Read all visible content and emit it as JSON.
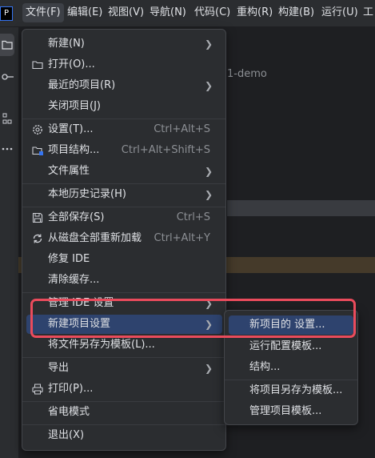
{
  "menubar": {
    "logo": "P",
    "items": [
      "文件(F)",
      "编辑(E)",
      "视图(V)",
      "导航(N)",
      "代码(C)",
      "重构(R)",
      "构建(B)",
      "运行(U)",
      "工"
    ]
  },
  "background": {
    "project_text": "1-demo"
  },
  "file_menu": {
    "items": [
      {
        "label": "新建(N)",
        "shortcut": "",
        "icon": ""
      },
      {
        "label": "打开(O)...",
        "shortcut": "",
        "icon": "folder-icon"
      },
      {
        "label": "最近的项目(R)",
        "shortcut": "",
        "icon": ""
      },
      {
        "label": "关闭项目(J)",
        "shortcut": "",
        "icon": ""
      },
      {
        "label": "设置(T)...",
        "shortcut": "Ctrl+Alt+S",
        "icon": "gear-icon"
      },
      {
        "label": "项目结构...",
        "shortcut": "Ctrl+Alt+Shift+S",
        "icon": "project-structure-icon"
      },
      {
        "label": "文件属性",
        "shortcut": "",
        "icon": ""
      },
      {
        "label": "本地历史记录(H)",
        "shortcut": "",
        "icon": ""
      },
      {
        "label": "全部保存(S)",
        "shortcut": "Ctrl+S",
        "icon": "save-icon"
      },
      {
        "label": "从磁盘全部重新加载",
        "shortcut": "Ctrl+Alt+Y",
        "icon": "reload-icon"
      },
      {
        "label": "修复 IDE",
        "shortcut": "",
        "icon": ""
      },
      {
        "label": "清除缓存...",
        "shortcut": "",
        "icon": ""
      },
      {
        "label": "管理 IDE 设置",
        "shortcut": "",
        "icon": ""
      },
      {
        "label": "新建项目设置",
        "shortcut": "",
        "icon": ""
      },
      {
        "label": "将文件另存为模板(L)...",
        "shortcut": "",
        "icon": ""
      },
      {
        "label": "导出",
        "shortcut": "",
        "icon": ""
      },
      {
        "label": "打印(P)...",
        "shortcut": "",
        "icon": "print-icon"
      },
      {
        "label": "省电模式",
        "shortcut": "",
        "icon": ""
      },
      {
        "label": "退出(X)",
        "shortcut": "",
        "icon": ""
      }
    ]
  },
  "new_project_settings_submenu": {
    "items": [
      "新项目的 设置...",
      "运行配置模板...",
      "结构...",
      "将项目另存为模板...",
      "管理项目模板..."
    ]
  },
  "colors": {
    "highlight": "#2e436e",
    "annotation": "#ea4b5c"
  }
}
